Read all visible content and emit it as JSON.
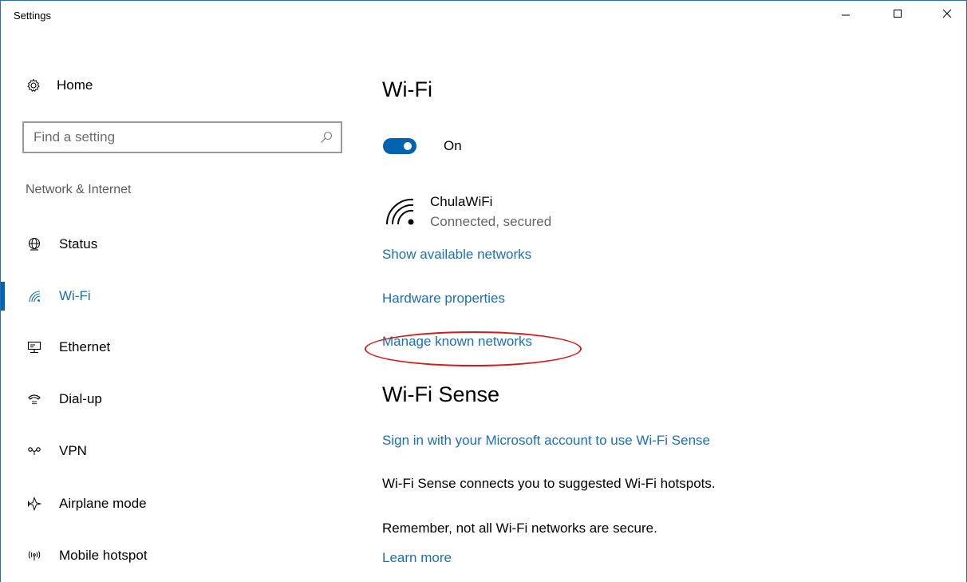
{
  "window": {
    "title": "Settings",
    "controls": {
      "minimize": "minimize-icon",
      "maximize": "maximize-icon",
      "close": "close-icon"
    }
  },
  "sidebar": {
    "home_label": "Home",
    "search": {
      "placeholder": "Find a setting"
    },
    "group_label": "Network & Internet",
    "items": [
      {
        "label": "Status",
        "icon": "globe-icon"
      },
      {
        "label": "Wi-Fi",
        "icon": "wifi-icon",
        "active": true
      },
      {
        "label": "Ethernet",
        "icon": "ethernet-icon"
      },
      {
        "label": "Dial-up",
        "icon": "dialup-icon"
      },
      {
        "label": "VPN",
        "icon": "vpn-icon"
      },
      {
        "label": "Airplane mode",
        "icon": "airplane-icon"
      },
      {
        "label": "Mobile hotspot",
        "icon": "hotspot-icon"
      }
    ]
  },
  "main": {
    "wifi_heading": "Wi-Fi",
    "toggle_state": "On",
    "network": {
      "name": "ChulaWiFi",
      "status": "Connected, secured"
    },
    "links": {
      "show_networks": "Show available networks",
      "hardware": "Hardware properties",
      "manage": "Manage known networks"
    },
    "sense_heading": "Wi-Fi Sense",
    "sense_signin": "Sign in with your Microsoft account to use Wi-Fi Sense",
    "sense_desc": "Wi-Fi Sense connects you to suggested Wi-Fi hotspots.",
    "security_note": "Remember, not all Wi-Fi networks are secure.",
    "learn_more": "Learn more"
  },
  "colors": {
    "accent": "#0063b1",
    "link": "#1b6fb5",
    "highlight": "#d11c1c"
  }
}
